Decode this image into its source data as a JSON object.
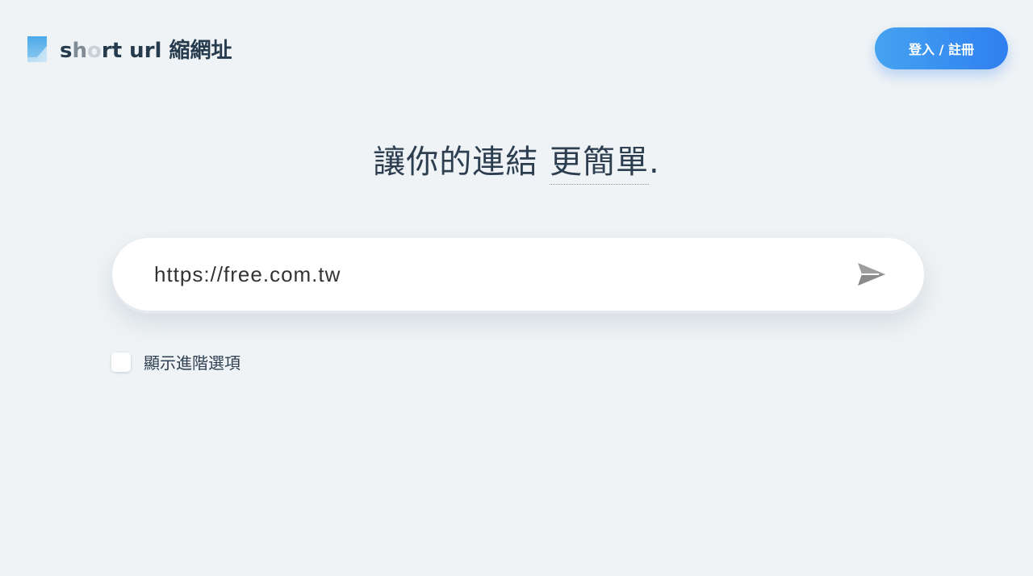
{
  "header": {
    "logo_text_prefix": "s",
    "logo_text_fade1": "h",
    "logo_text_fade2": "o",
    "logo_text_rest": "rt url 縮網址",
    "auth_button_label": "登入 / 註冊"
  },
  "hero": {
    "headline_main": "讓你的連結 ",
    "headline_emphasis": "更簡單",
    "headline_end": "."
  },
  "form": {
    "url_value": "https://free.com.tw",
    "submit_icon": "send-icon"
  },
  "options": {
    "advanced_label": "顯示進階選項",
    "advanced_checked": false
  },
  "colors": {
    "background": "#eff3f5",
    "text": "#2c3e50",
    "accent_start": "#45a3f0",
    "accent_end": "#2f7ff0",
    "send_icon": "#9e9e9e"
  }
}
